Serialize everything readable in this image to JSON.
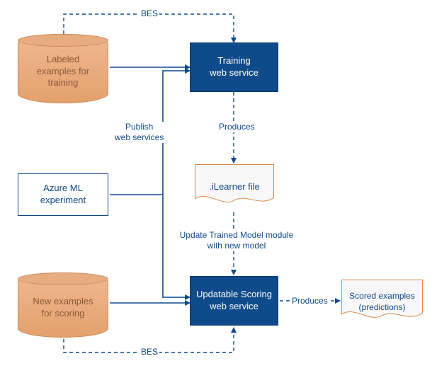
{
  "nodes": {
    "labeled_data": "Labeled\nexamples for\ntraining",
    "training_ws": "Training\nweb service",
    "azure_ml": "Azure ML\nexperiment",
    "ilearner": ".iLearner file",
    "scoring_ws": "Updatable Scoring\nweb service",
    "new_examples": "New examples\nfor scoring",
    "scored": "Scored examples\n(predictions)"
  },
  "labels": {
    "bes1": "BES",
    "bes2": "BES",
    "publish": "Publish\nweb services",
    "produces1": "Produces",
    "update": "Update Trained Model module\nwith new model",
    "produces2": "Produces"
  }
}
